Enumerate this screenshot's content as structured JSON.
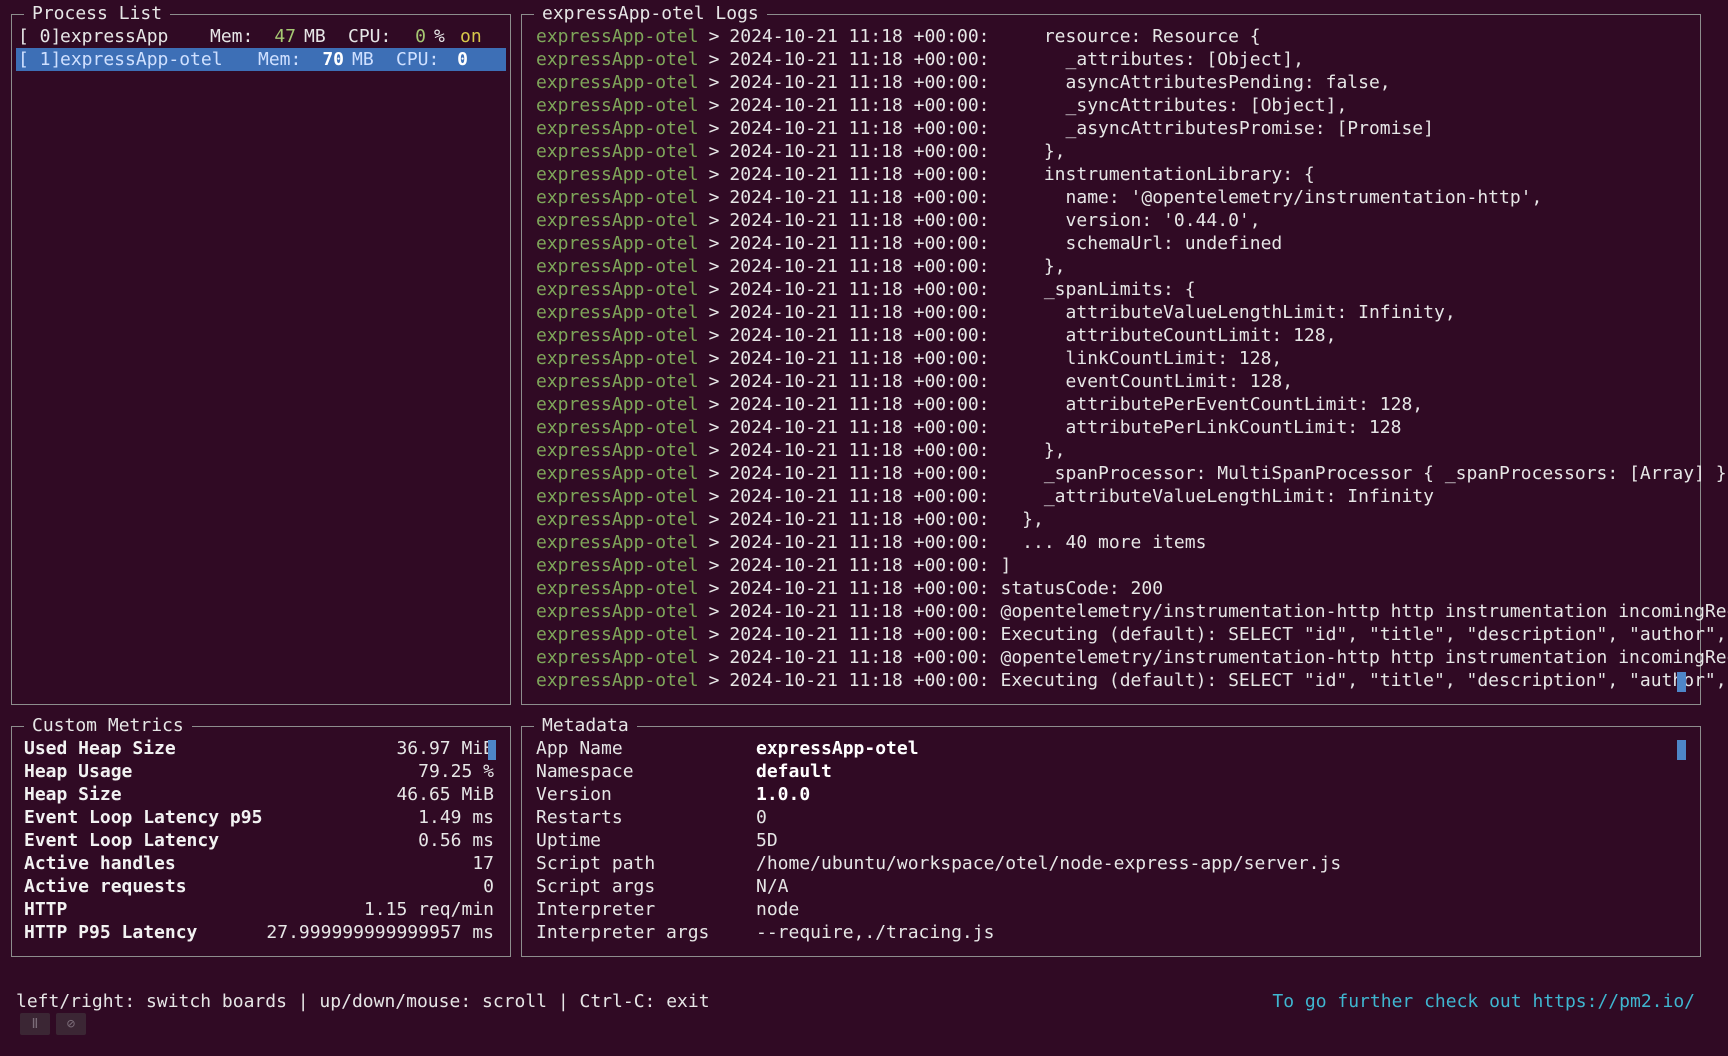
{
  "process_list": {
    "title": "Process List",
    "rows": [
      {
        "index": "[ 0]",
        "name": "expressApp",
        "mem_label": "Mem:",
        "mem_value": "47",
        "mem_unit": "MB",
        "cpu_label": "CPU:",
        "cpu_value": "0",
        "cpu_unit": "%",
        "status": "on",
        "selected": false
      },
      {
        "index": "[ 1]",
        "name": "expressApp-otel",
        "mem_label": "Mem:",
        "mem_value": "70",
        "mem_unit": "MB",
        "cpu_label": "CPU:",
        "cpu_value": "0",
        "cpu_unit": "",
        "status": "",
        "selected": true
      }
    ]
  },
  "logs": {
    "title": "expressApp-otel Logs",
    "app": "expressApp-otel",
    "separator": ">",
    "timestamp": "2024-10-21 11:18 +00:00:",
    "lines": [
      "    resource: Resource {",
      "      _attributes: [Object],",
      "      asyncAttributesPending: false,",
      "      _syncAttributes: [Object],",
      "      _asyncAttributesPromise: [Promise]",
      "    },",
      "    instrumentationLibrary: {",
      "      name: '@opentelemetry/instrumentation-http',",
      "      version: '0.44.0',",
      "      schemaUrl: undefined",
      "    },",
      "    _spanLimits: {",
      "      attributeValueLengthLimit: Infinity,",
      "      attributeCountLimit: 128,",
      "      linkCountLimit: 128,",
      "      eventCountLimit: 128,",
      "      attributePerEventCountLimit: 128,",
      "      attributePerLinkCountLimit: 128",
      "    },",
      "    _spanProcessor: MultiSpanProcessor { _spanProcessors: [Array] },",
      "    _attributeValueLengthLimit: Infinity",
      "  },",
      "  ... 40 more items",
      "]",
      "statusCode: 200",
      "@opentelemetry/instrumentation-http http instrumentation incomingReques",
      "Executing (default): SELECT \"id\", \"title\", \"description\", \"author\",",
      "@opentelemetry/instrumentation-http http instrumentation incomingReques",
      "Executing (default): SELECT \"id\", \"title\", \"description\", \"author\","
    ]
  },
  "metrics": {
    "title": "Custom Metrics",
    "items": [
      {
        "label": "Used Heap Size",
        "value": "36.97 MiB"
      },
      {
        "label": "Heap Usage",
        "value": "79.25 %"
      },
      {
        "label": "Heap Size",
        "value": "46.65 MiB"
      },
      {
        "label": "Event Loop Latency p95",
        "value": "1.49 ms"
      },
      {
        "label": "Event Loop Latency",
        "value": "0.56 ms"
      },
      {
        "label": "Active handles",
        "value": "17"
      },
      {
        "label": "Active requests",
        "value": "0"
      },
      {
        "label": "HTTP",
        "value": "1.15 req/min"
      },
      {
        "label": "HTTP P95 Latency",
        "value": "27.999999999999957 ms"
      }
    ]
  },
  "metadata": {
    "title": "Metadata",
    "items": [
      {
        "key": "App Name",
        "value": "expressApp-otel",
        "bold": true
      },
      {
        "key": "Namespace",
        "value": "default",
        "bold": true
      },
      {
        "key": "Version",
        "value": "1.0.0",
        "bold": true
      },
      {
        "key": "Restarts",
        "value": "0",
        "bold": false
      },
      {
        "key": "Uptime",
        "value": "5D",
        "bold": false
      },
      {
        "key": "Script path",
        "value": "/home/ubuntu/workspace/otel/node-express-app/server.js",
        "bold": false
      },
      {
        "key": "Script args",
        "value": "N/A",
        "bold": false
      },
      {
        "key": "Interpreter",
        "value": "node",
        "bold": false
      },
      {
        "key": "Interpreter args",
        "value": "--require,./tracing.js",
        "bold": false
      }
    ]
  },
  "footer": {
    "help": "left/right: switch boards | up/down/mouse: scroll | Ctrl-C: exit",
    "link_text": "To go further check out https://pm2.io/",
    "pause_icon": "Ⅱ",
    "mute_icon": "⊘"
  }
}
